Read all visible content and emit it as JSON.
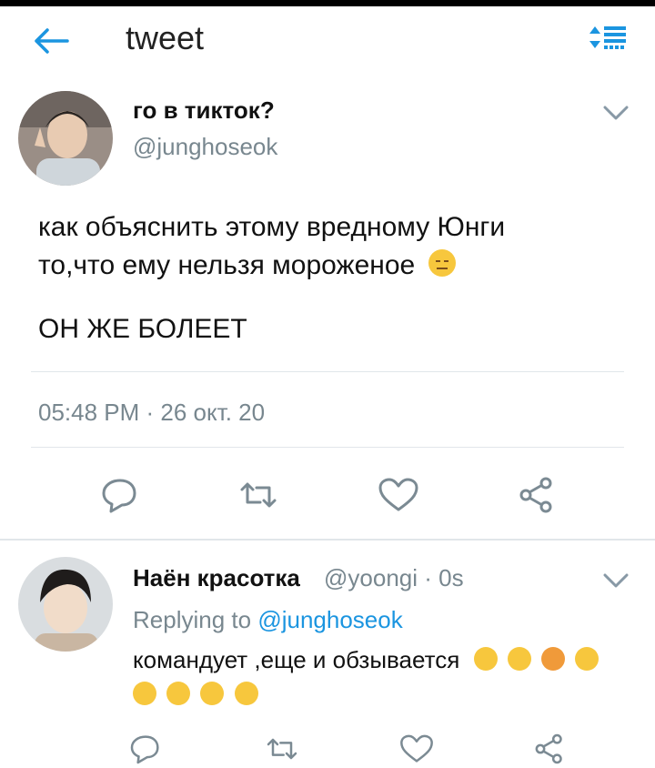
{
  "header": {
    "title": "tweet",
    "back_icon": "arrow-left-icon",
    "sort_icon": "sort-list-icon",
    "accent": "#1b95e0"
  },
  "main_tweet": {
    "display_name": "го в тикток?",
    "handle": "@junghoseok",
    "text_line1": "как объяснить этому вредному Юнги",
    "text_line2": "то,что ему нельзя мороженое",
    "text_line3": "ОН ЖЕ БОЛЕЕТ",
    "emoji": "expressionless-face",
    "timestamp": "05:48 PM · 26 окт. 20"
  },
  "reply": {
    "display_name": "Наён красотка",
    "handle_time": "@yoongi · 0s",
    "replying_prefix": "Replying to",
    "replying_handle": "@junghoseok",
    "text": "командует ,еще и обзывается",
    "emojis": [
      "pensive-face",
      "disappointed-face",
      "angry-face",
      "confused-face",
      "persevering-face",
      "frowning-face",
      "persevering-face",
      "frowning-face"
    ]
  },
  "actions": [
    "reply-icon",
    "retweet-icon",
    "like-icon",
    "share-icon"
  ]
}
